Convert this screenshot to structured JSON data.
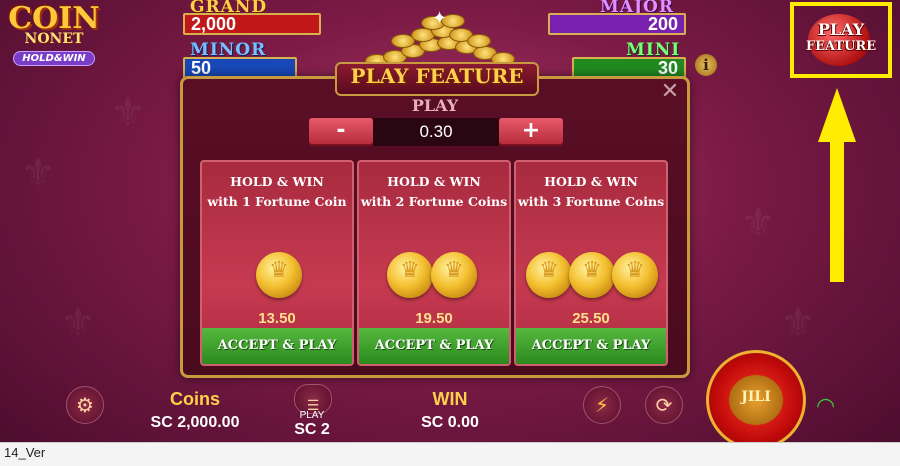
{
  "game": {
    "logo_line1": "COIN",
    "logo_line2": "NONET",
    "logo_line3": "HOLD&WIN"
  },
  "jackpots": {
    "grand": {
      "label": "GRAND",
      "value": "2,000",
      "color": "#c01818"
    },
    "minor": {
      "label": "MINOR",
      "value": "50",
      "color": "#1848b8"
    },
    "major": {
      "label": "MAJOR",
      "value": "200",
      "color": "#7a20b0"
    },
    "mini": {
      "label": "MINI",
      "value": "30",
      "color": "#208a20"
    }
  },
  "top_button": {
    "line1": "PLAY",
    "line2": "FEATURE",
    "highlight_color": "#ffec00"
  },
  "modal": {
    "title": "PLAY FEATURE",
    "close": "✕",
    "play_label": "PLAY",
    "minus": "-",
    "plus": "+",
    "bet_value": "0.30",
    "cards": [
      {
        "title_line1": "HOLD & WIN",
        "title_line2": "with 1 Fortune Coin",
        "coins": 1,
        "price": "13.50",
        "button": "ACCEPT & PLAY"
      },
      {
        "title_line1": "HOLD & WIN",
        "title_line2": "with 2 Fortune Coins",
        "coins": 2,
        "price": "19.50",
        "button": "ACCEPT & PLAY"
      },
      {
        "title_line1": "HOLD & WIN",
        "title_line2": "with 3 Fortune Coins",
        "coins": 3,
        "price": "25.50",
        "button": "ACCEPT & PLAY"
      }
    ]
  },
  "bottom_bar": {
    "coins_label": "Coins",
    "coins_value": "SC 2,000.00",
    "play_label": "PLAY",
    "play_value": "SC 2",
    "win_label": "WIN",
    "win_value": "SC 0.00",
    "spin_brand": "JILI",
    "icons": [
      "gear-icon",
      "coin-stack-icon",
      "lightning-icon",
      "autoplay-icon",
      "wifi-icon"
    ]
  },
  "footer": {
    "version": "14_Ver"
  }
}
